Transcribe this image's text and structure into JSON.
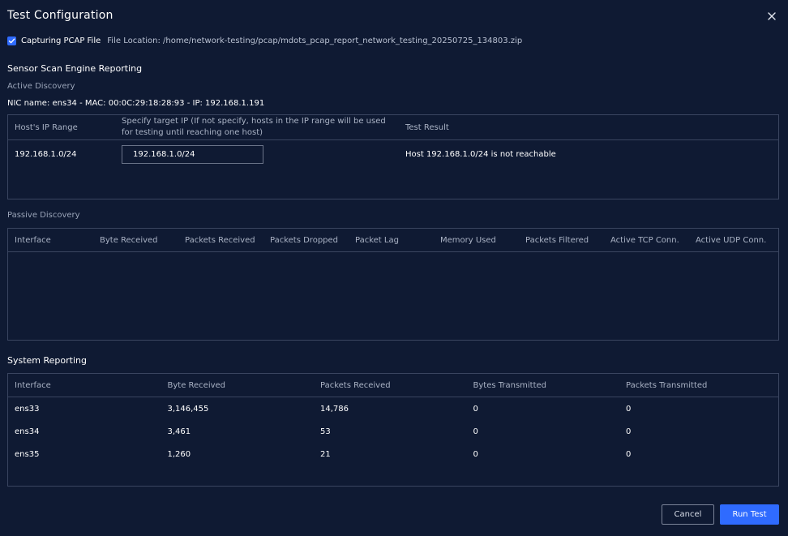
{
  "dialog": {
    "title": "Test Configuration"
  },
  "pcap": {
    "checked": true,
    "label": "Capturing PCAP File",
    "file_location": "File Location: /home/network-testing/pcap/mdots_pcap_report_network_testing_20250725_134803.zip"
  },
  "sensor_section": {
    "title": "Sensor Scan Engine Reporting"
  },
  "active_discovery": {
    "title": "Active Discovery",
    "nic_line": "NIC name: ens34 - MAC: 00:0C:29:18:28:93 - IP: 192.168.1.191",
    "columns": [
      "Host's IP Range",
      "Specify target IP (If not specify, hosts in the IP range will be used for testing until reaching one host)",
      "Test Result"
    ],
    "rows": [
      {
        "range": "192.168.1.0/24",
        "target_ip": "192.168.1.0/24",
        "result": "Host 192.168.1.0/24 is not reachable"
      }
    ]
  },
  "passive_discovery": {
    "title": "Passive Discovery",
    "columns": [
      "Interface",
      "Byte Received",
      "Packets Received",
      "Packets Dropped",
      "Packet Lag",
      "Memory Used",
      "Packets Filtered",
      "Active TCP Conn.",
      "Active UDP Conn."
    ]
  },
  "system_reporting": {
    "title": "System Reporting",
    "columns": [
      "Interface",
      "Byte Received",
      "Packets Received",
      "Bytes Transmitted",
      "Packets Transmitted"
    ],
    "rows": [
      [
        "ens33",
        "3,146,455",
        "14,786",
        "0",
        "0"
      ],
      [
        "ens34",
        "3,461",
        "53",
        "0",
        "0"
      ],
      [
        "ens35",
        "1,260",
        "21",
        "0",
        "0"
      ]
    ]
  },
  "footer": {
    "cancel_label": "Cancel",
    "run_label": "Run Test"
  },
  "colors": {
    "background": "#0f1a33",
    "accent": "#2f6bff",
    "border": "#3a4560"
  }
}
